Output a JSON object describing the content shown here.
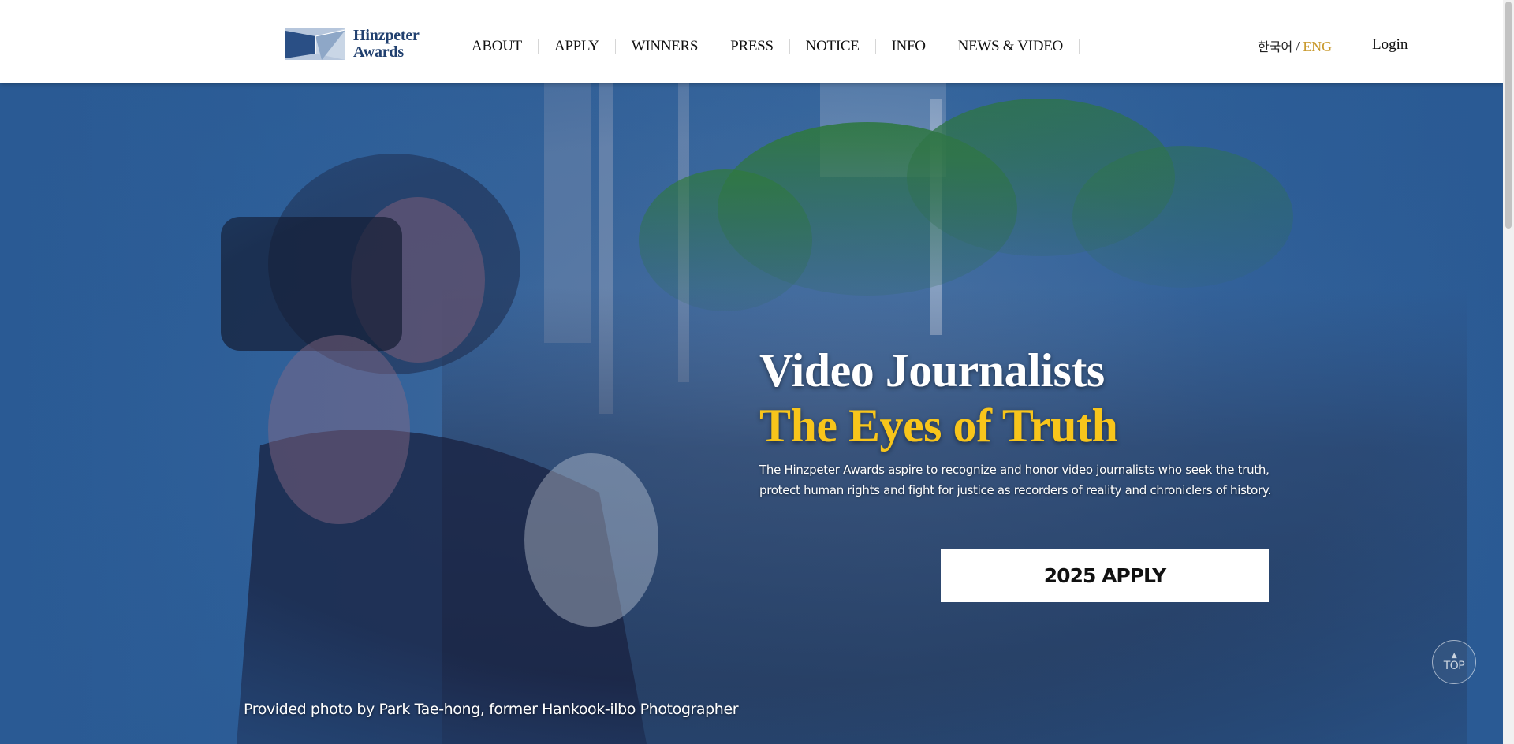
{
  "header": {
    "logo": {
      "line1": "Hinzpeter",
      "line2": "Awards",
      "icon": "hinzpeter-awards-logo-icon"
    },
    "nav": [
      {
        "label": "ABOUT"
      },
      {
        "label": "APPLY"
      },
      {
        "label": "WINNERS"
      },
      {
        "label": "PRESS"
      },
      {
        "label": "NOTICE"
      },
      {
        "label": "INFO"
      },
      {
        "label": "NEWS & VIDEO"
      }
    ],
    "lang": {
      "ko": "한국어",
      "separator": "/",
      "en": "ENG",
      "active": "ENG"
    },
    "login": "Login"
  },
  "hero": {
    "title": "Video Journalists",
    "subtitle": "The Eyes of Truth",
    "description_line1": "The Hinzpeter Awards aspire to recognize and honor video journalists who seek the truth,",
    "description_line2": "protect human rights and fight for justice as recorders of reality and chroniclers of history.",
    "apply_button": "2025 APPLY",
    "photo_credit": "Provided photo by Park Tae-hong, former Hankook-ilbo Photographer"
  },
  "top_button": {
    "label": "TOP",
    "icon": "arrow-up-icon"
  },
  "colors": {
    "brand_navy": "#21406f",
    "accent_gold": "#c99a2e",
    "hero_yellow": "#f8c51b",
    "hero_overlay_blue": "#2b5a93",
    "header_bg": "#ffffff"
  }
}
